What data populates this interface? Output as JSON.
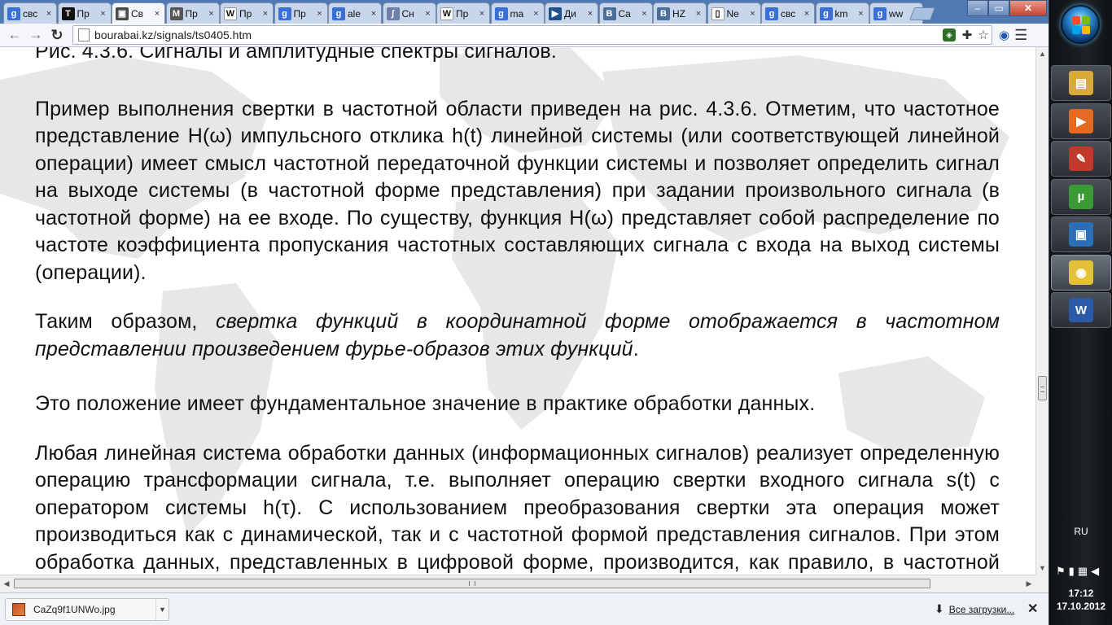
{
  "browser": {
    "tabs": [
      {
        "label": "свс",
        "icon": "google-icon",
        "color": "#3b6fd8",
        "glyph": "g"
      },
      {
        "label": "Пр",
        "icon": "tor-icon",
        "color": "#111111",
        "glyph": "T"
      },
      {
        "label": "Св",
        "icon": "book-icon",
        "color": "#4a4a4a",
        "glyph": "▣"
      },
      {
        "label": "Пр",
        "icon": "scholar-icon",
        "color": "#555555",
        "glyph": "M"
      },
      {
        "label": "Пр",
        "icon": "wikipedia-icon",
        "color": "#ffffff",
        "glyph": "W"
      },
      {
        "label": "Пр",
        "icon": "google-icon",
        "color": "#3b6fd8",
        "glyph": "g"
      },
      {
        "label": "ale",
        "icon": "google-icon",
        "color": "#3b6fd8",
        "glyph": "g"
      },
      {
        "label": "Сн",
        "icon": "script-icon",
        "color": "#6d7fa8",
        "glyph": "∫"
      },
      {
        "label": "Пр",
        "icon": "wikipedia-icon",
        "color": "#ffffff",
        "glyph": "W"
      },
      {
        "label": "ma",
        "icon": "google-icon",
        "color": "#3b6fd8",
        "glyph": "g"
      },
      {
        "label": "Ди",
        "icon": "video-icon",
        "color": "#1e4f8f",
        "glyph": "▶"
      },
      {
        "label": "Ca",
        "icon": "vk-icon",
        "color": "#4a6f9a",
        "glyph": "B"
      },
      {
        "label": "HZ",
        "icon": "vk-icon",
        "color": "#4a6f9a",
        "glyph": "B"
      },
      {
        "label": "Ne",
        "icon": "page-icon",
        "color": "#ffffff",
        "glyph": "▯"
      },
      {
        "label": "свс",
        "icon": "google-icon",
        "color": "#3b6fd8",
        "glyph": "g"
      },
      {
        "label": "km",
        "icon": "google-icon",
        "color": "#3b6fd8",
        "glyph": "g"
      },
      {
        "label": "ww",
        "icon": "google-icon",
        "color": "#3b6fd8",
        "glyph": "g"
      }
    ],
    "active_tab": 2,
    "url": "bourabai.kz/signals/ts0405.htm"
  },
  "page": {
    "caption": "Рис. 4.3.6. Сигналы и амплитудные спектры сигналов.",
    "p1": "Пример выполнения свертки в частотной области приведен на рис. 4.3.6. Отметим, что частотное представление H(ω) импульсного отклика h(t) линейной системы (или соответствующей линейной операции) имеет смысл частотной передаточной функции системы и позволяет определить сигнал на выходе системы (в частотной форме представления) при задании произвольного сигнала (в частотной форме) на ее входе. По существу, функция H(ω) представляет собой распределение по частоте коэффициента пропускания частотных составляющих сигнала с входа на выход системы (операции).",
    "p2_prefix": "Таким образом, ",
    "p2_italic": "свертка функций в координатной форме отображается в частотном представлении произведением фурье-образов этих функций",
    "p2_suffix": ".",
    "p3": "Это положение имеет фундаментальное значение в практике обработки данных.",
    "p4": "Любая линейная система обработки данных (информационных сигналов) реализует определенную операцию трансформации сигнала, т.е. выполняет операцию свертки входного сигнала s(t) с оператором системы h(τ). С использованием преобразования свертки эта операция может производиться как с динамической, так и с частотной формой представления сигналов. При этом обработка данных, представленных в цифровой форме, производится, как правило, в частотной области, т.к. может быть на несколько"
  },
  "download_shelf": {
    "file_name": "CaZq9f1UNWo.jpg",
    "all_downloads": "Все загрузки..."
  },
  "taskbar": {
    "buttons": [
      {
        "name": "explorer-app-icon",
        "color": "#d9a93a",
        "glyph": "▤"
      },
      {
        "name": "media-player-icon",
        "color": "#e36a1e",
        "glyph": "▶"
      },
      {
        "name": "paint-app-icon",
        "color": "#c0392b",
        "glyph": "✎"
      },
      {
        "name": "utorrent-icon",
        "color": "#3a9a35",
        "glyph": "µ"
      },
      {
        "name": "remote-desktop-icon",
        "color": "#2a6fb8",
        "glyph": "▣"
      },
      {
        "name": "chrome-icon",
        "color": "#e2c23a",
        "glyph": "◉"
      },
      {
        "name": "word-icon",
        "color": "#2b5aa8",
        "glyph": "W"
      }
    ],
    "active_button": 5,
    "language": "RU",
    "time": "17:12",
    "date": "17.10.2012"
  },
  "colors": {
    "tabstrip": "#5079b3",
    "page_text": "#111111",
    "taskbar": "#1a1d21"
  }
}
